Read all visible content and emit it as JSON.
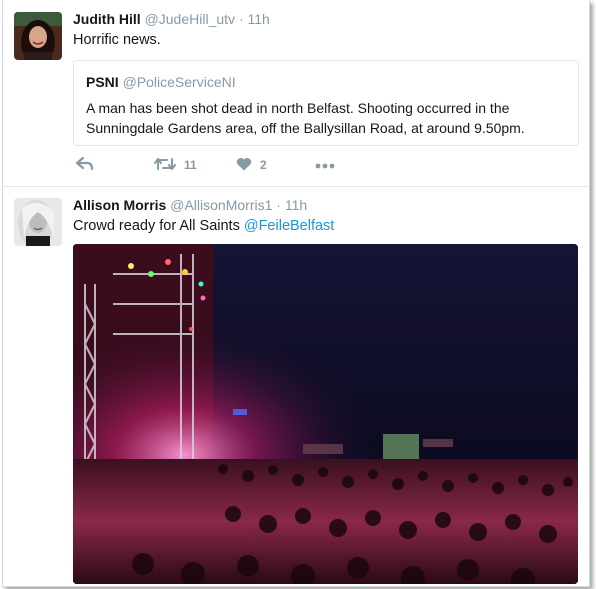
{
  "tweets": [
    {
      "name": "Judith Hill",
      "handle": "@JudeHill_utv",
      "separator": "·",
      "time": "11h",
      "text": "Horrific news.",
      "quote": {
        "name": "PSNI",
        "handle": "@PoliceServiceNI",
        "text": "A man has been shot dead in north Belfast. Shooting occurred in the Sunningdale Gardens area, off the Ballysillan Road, at around 9.50pm."
      },
      "actions": {
        "reply_icon": "reply-icon",
        "retweet_icon": "retweet-icon",
        "retweet_count": "11",
        "like_icon": "heart-icon",
        "like_count": "2",
        "more_icon": "more-dots-icon"
      }
    },
    {
      "name": "Allison Morris",
      "handle": "@AllisonMorris1",
      "separator": "·",
      "time": "11h",
      "text": "Crowd ready for All Saints",
      "mention": "@FeileBelfast"
    }
  ],
  "colors": {
    "link": "#1b95e0",
    "meta": "#8899a6",
    "border": "#e1e8ed"
  }
}
